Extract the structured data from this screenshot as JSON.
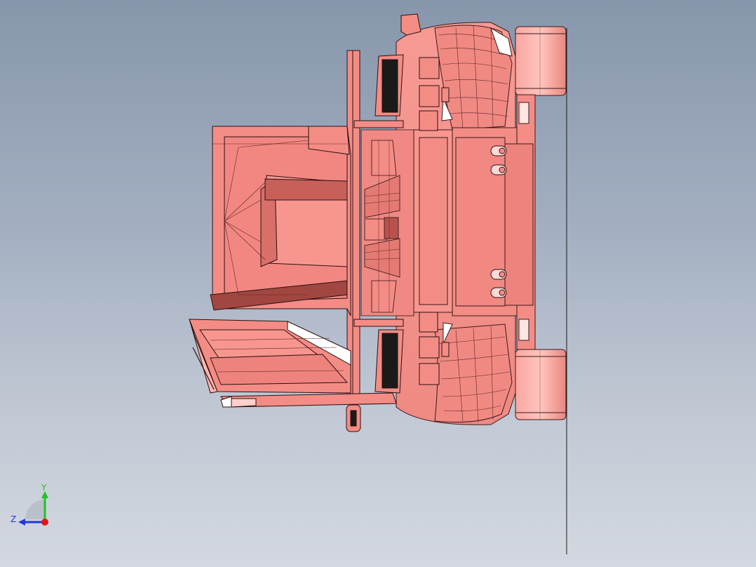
{
  "viewport": {
    "background_top": "#8796ab",
    "background_bottom": "#d3d8e0",
    "model_color": "#f48c86",
    "model_shade": "#d06a65",
    "model_highlight": "#ffd6d2",
    "edge_color": "#2a1010"
  },
  "triad": {
    "y_label": "Y",
    "z_label": "Z",
    "y_color": "#22c02a",
    "z_color": "#2338d9",
    "x_color": "#e01818"
  }
}
